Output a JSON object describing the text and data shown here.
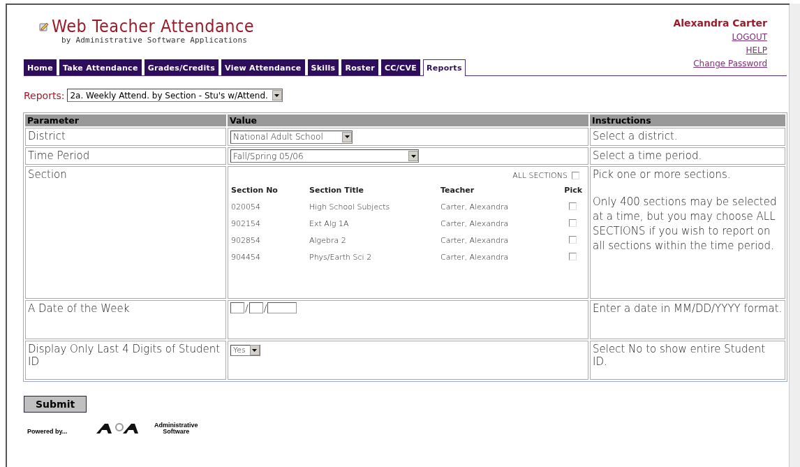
{
  "header": {
    "title": "Web Teacher Attendance",
    "subtitle": "by Administrative Software Applications"
  },
  "user": {
    "name": "Alexandra Carter",
    "links": [
      "LOGOUT",
      "HELP",
      "Change Password"
    ]
  },
  "tabs": [
    {
      "label": "Home",
      "selected": false
    },
    {
      "label": "Take Attendance",
      "selected": false
    },
    {
      "label": "Grades/Credits",
      "selected": false
    },
    {
      "label": "View Attendance",
      "selected": false
    },
    {
      "label": "Skills",
      "selected": false
    },
    {
      "label": "Roster",
      "selected": false
    },
    {
      "label": "CC/CVE",
      "selected": false
    },
    {
      "label": "Reports",
      "selected": true
    }
  ],
  "reports": {
    "label": "Reports:",
    "value": "2a. Weekly Attend. by Section - Stu's w/Attend."
  },
  "table": {
    "columns": [
      "Parameter",
      "Value",
      "Instructions"
    ],
    "rows": [
      {
        "kind": "select",
        "label": "District",
        "value": "National Adult School",
        "instructions": "Select a district."
      },
      {
        "kind": "select",
        "label": "Time Period",
        "value": "Fall/Spring 05/06",
        "instructions": "Select a time period."
      },
      {
        "kind": "sections",
        "label": "Section",
        "instructions": "Pick one or more sections.",
        "instructions_2": "Only 400 sections may be selected at a time, but you may choose ALL SECTIONS if you wish to report on all sections within the time period.",
        "all_sections": {
          "label": "ALL SECTIONS",
          "checked": false
        },
        "columns": [
          "Section No",
          "Section Title",
          "Teacher",
          "Pick"
        ],
        "sections": [
          {
            "number": "020054",
            "title": "High School Subjects",
            "teacher": "Carter, Alexandra",
            "checked": false
          },
          {
            "number": "902154",
            "title": "Ext Alg 1A",
            "teacher": "Carter, Alexandra",
            "checked": false
          },
          {
            "number": "902854",
            "title": "Algebra 2",
            "teacher": "Carter, Alexandra",
            "checked": false
          },
          {
            "number": "904454",
            "title": "Phys/Earth Sci 2",
            "teacher": "Carter, Alexandra",
            "checked": false
          }
        ]
      },
      {
        "kind": "date",
        "label": "A Date of the Week",
        "separators": [
          "/",
          "/"
        ],
        "instructions": "Enter a date in MM/DD/YYYY format."
      },
      {
        "kind": "small-select",
        "label": "Display Only Last 4 Digits of Student ID",
        "value": "Yes",
        "instructions": "Select No to show entire Student ID."
      }
    ]
  },
  "submit": "Submit",
  "footer": {
    "powered_by": "Powered by...",
    "logo_text": "Administrative Software"
  }
}
